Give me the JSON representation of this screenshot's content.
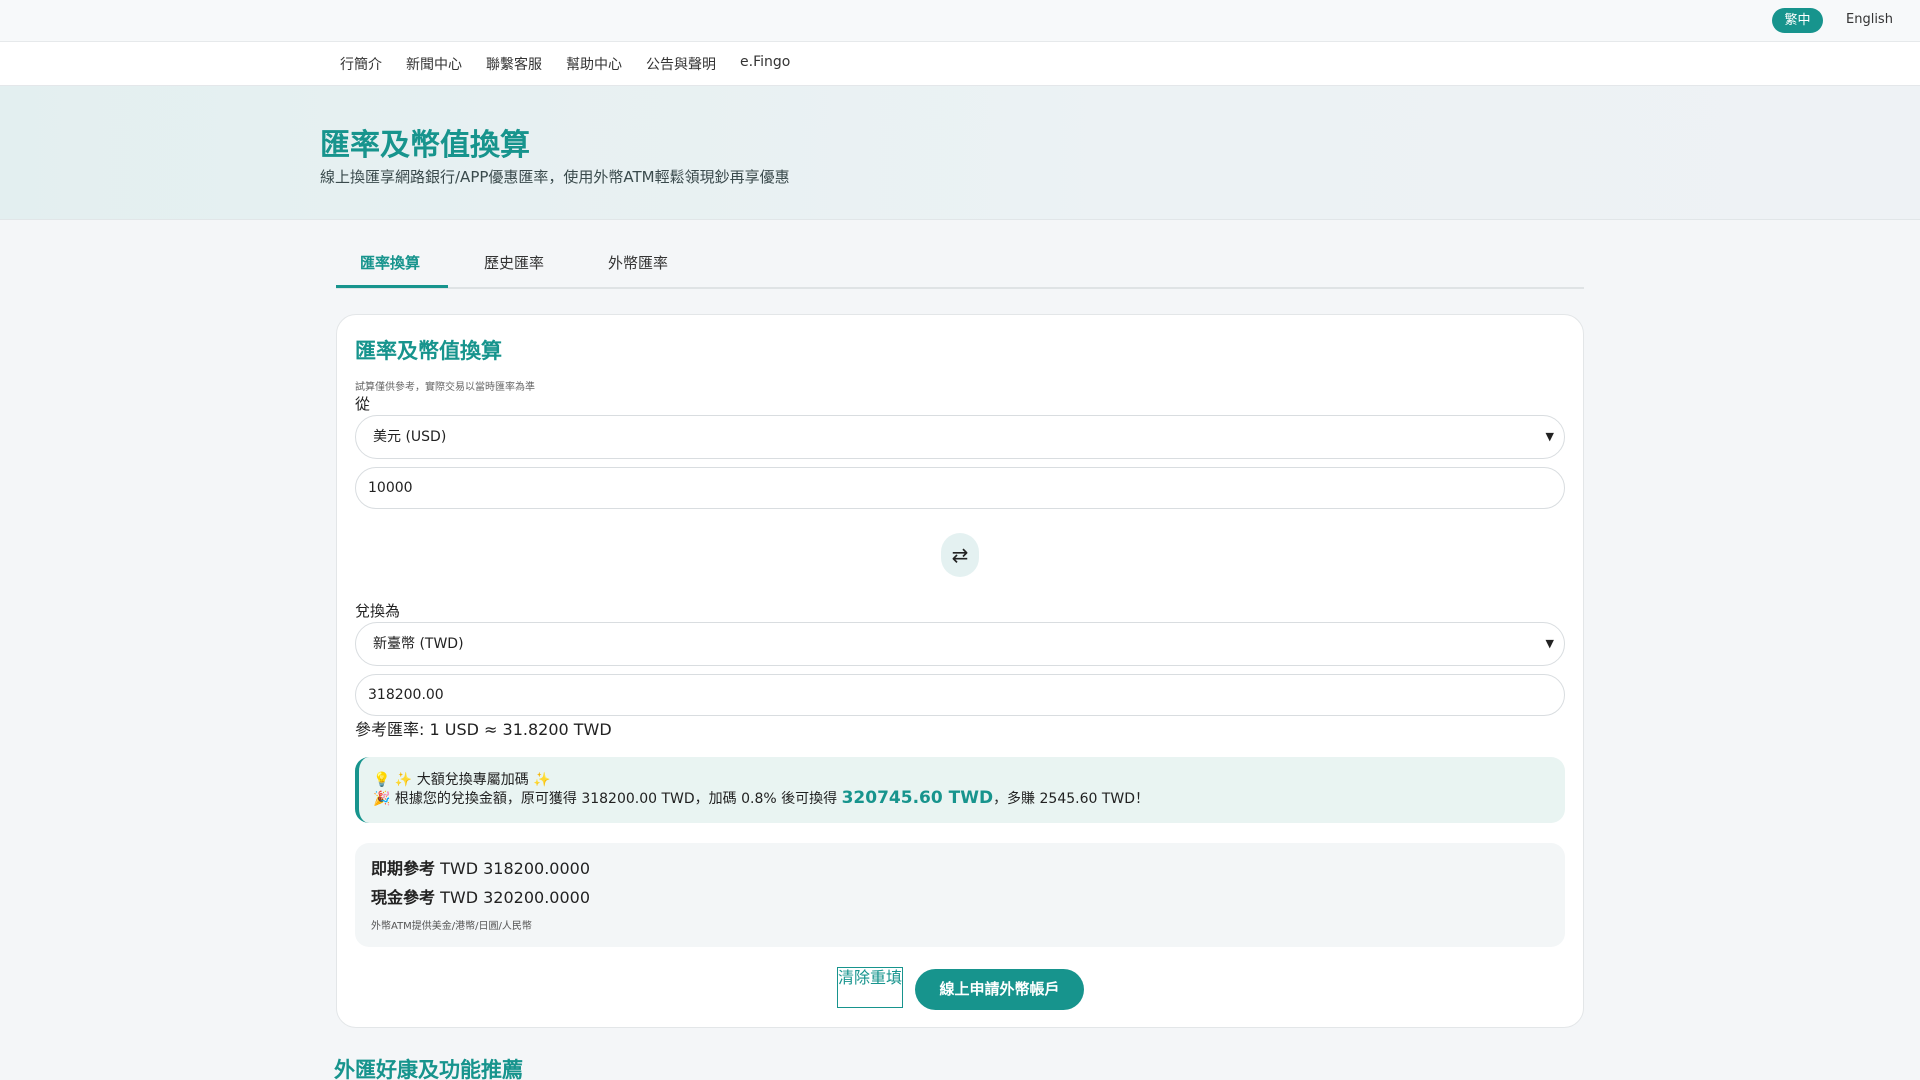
{
  "lang": {
    "zh": "繁中",
    "en": "English"
  },
  "nav": [
    "行簡介",
    "新聞中心",
    "聯繫客服",
    "幫助中心",
    "公告與聲明",
    "e.Fingo"
  ],
  "hero": {
    "title": "匯率及幣值換算",
    "subtitle": "線上換匯享網路銀行/APP優惠匯率，使用外幣ATM輕鬆領現鈔再享優惠"
  },
  "tabs": [
    "匯率換算",
    "歷史匯率",
    "外幣匯率"
  ],
  "converter": {
    "title": "匯率及幣值換算",
    "note": "試算僅供參考，實際交易以當時匯率為準",
    "from_label": "從",
    "from_currency": "美元 (USD)",
    "from_amount": "10000",
    "swap_icon": "⇄",
    "to_label": "兌換為",
    "to_currency": "新臺幣 (TWD)",
    "to_amount": "318200.00",
    "rate_ref": "參考匯率: 1 USD ≈ 31.8200 TWD"
  },
  "promo": {
    "line1": "💡 ✨ 大額兌換專屬加碼 ✨",
    "line2_pre": "🎉 根據您的兌換金額，原可獲得 318200.00 TWD，加碼 0.8% 後可換得 ",
    "line2_highlight": "320745.60 TWD",
    "line2_post": "，多賺 2545.60 TWD！"
  },
  "quotes": {
    "spot_label": "即期參考",
    "spot_value": "TWD 318200.0000",
    "cash_label": "現金參考",
    "cash_value": "TWD 320200.0000",
    "atm_note": "外幣ATM提供美金/港幣/日圓/人民幣"
  },
  "buttons": {
    "clear": "清除重填",
    "apply": "線上申請外幣帳戶"
  },
  "section_title": "外匯好康及功能推薦",
  "colors": {
    "accent": "#17948d"
  }
}
